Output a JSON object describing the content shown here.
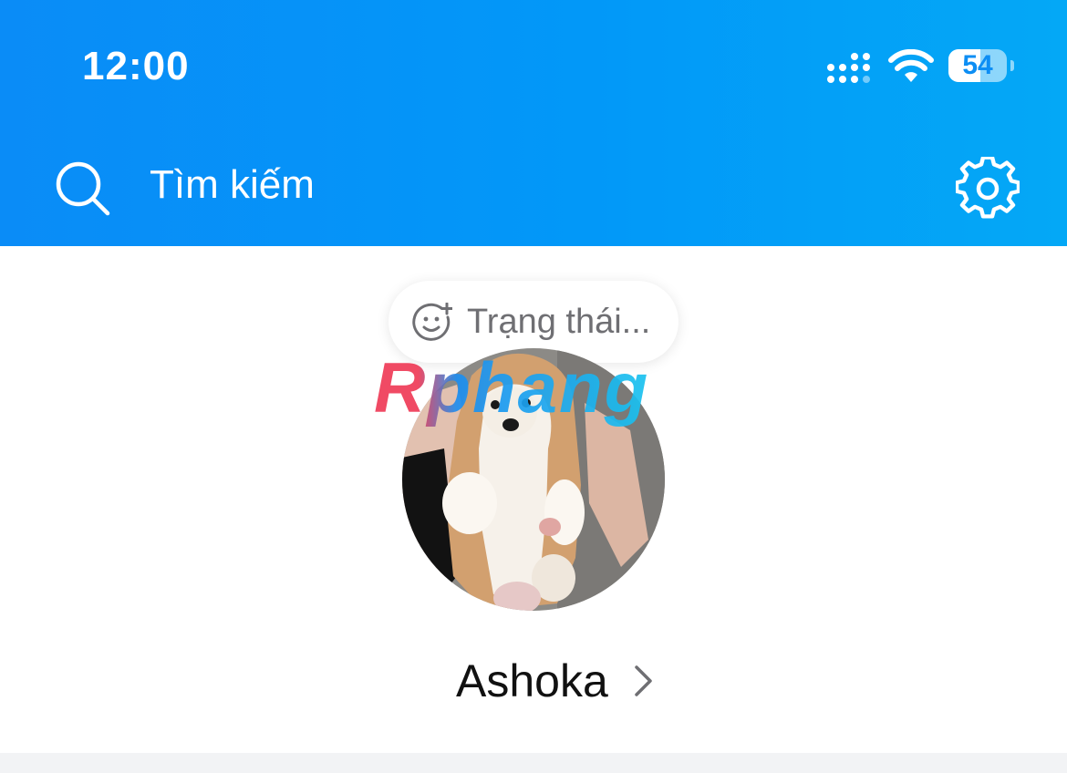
{
  "status_bar": {
    "time": "12:00",
    "battery_level": "54",
    "battery_fraction": 0.54,
    "icons": [
      "signal-icon",
      "wifi-icon",
      "battery-icon"
    ]
  },
  "header": {
    "search_placeholder": "Tìm kiếm",
    "icons": [
      "search-icon",
      "gear-icon"
    ],
    "colors": {
      "gradient_start": "#0a8cf7",
      "gradient_end": "#04a8f6"
    }
  },
  "profile": {
    "status_prompt": "Trạng thái...",
    "status_icon": "add-emoji-icon",
    "watermark": "Rphang",
    "name": "Ashoka",
    "name_icon": "chevron-right-icon"
  }
}
